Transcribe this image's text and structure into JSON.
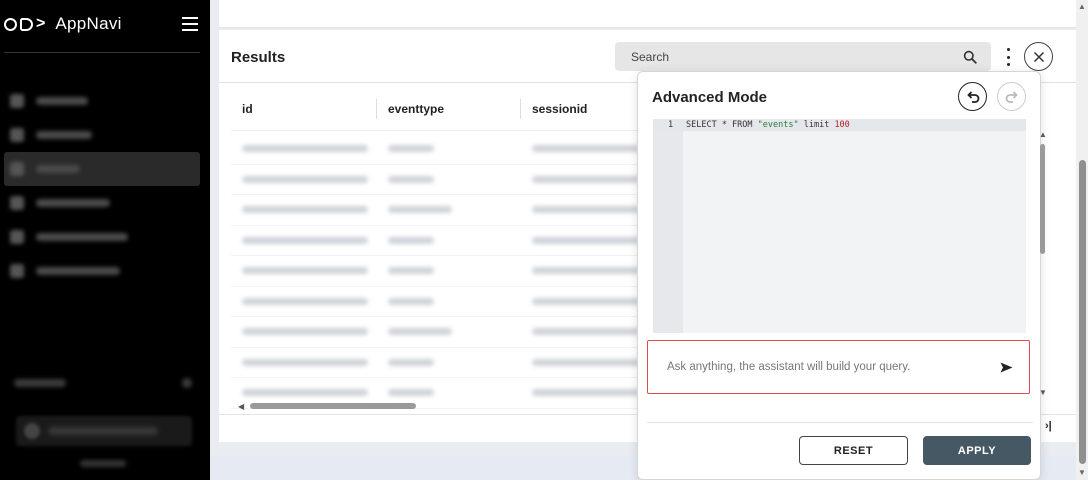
{
  "app": {
    "name": "AppNavi"
  },
  "results": {
    "title": "Results",
    "search_placeholder": "Search",
    "columns": [
      "id",
      "eventtype",
      "sessionid"
    ]
  },
  "advanced": {
    "title": "Advanced Mode",
    "editor": {
      "line_number": "1",
      "query_prefix": "SELECT * FROM ",
      "query_table": "\"events\"",
      "query_mid": " limit ",
      "query_limit": "100"
    },
    "assistant_placeholder": "Ask anything, the assistant will build your query.",
    "reset_label": "RESET",
    "apply_label": "APPLY"
  },
  "colors": {
    "accent": "#465863",
    "highlight_border": "#e24b4b"
  },
  "icons": [
    "menu-icon",
    "search-icon",
    "more-vertical-icon",
    "close-icon",
    "undo-icon",
    "redo-icon",
    "send-icon",
    "last-page-icon"
  ]
}
